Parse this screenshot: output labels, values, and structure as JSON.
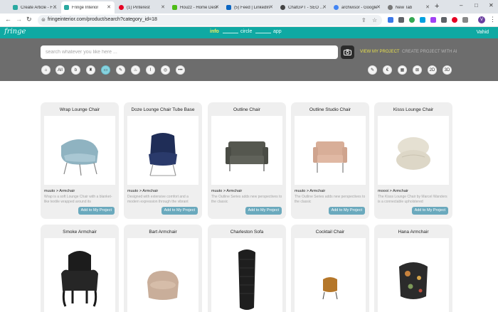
{
  "browser": {
    "tabs": [
      {
        "title": "Create Article - FRIN",
        "favicon_color": "#2aa9a0"
      },
      {
        "title": "Fringe Interior",
        "favicon_color": "#2aa9a0"
      },
      {
        "title": "(1) Pinterest",
        "favicon_color": "#e60023"
      },
      {
        "title": "Houzz - Home Desi",
        "favicon_color": "#4dbc15"
      },
      {
        "title": "(5) Feed | LinkedIn",
        "favicon_color": "#0a66c2"
      },
      {
        "title": "ChatGPT - SEO Blog",
        "favicon_color": "#444444"
      },
      {
        "title": "archivisor - Google",
        "favicon_color": "#4285f4"
      },
      {
        "title": "New Tab",
        "favicon_color": "#777777"
      }
    ],
    "new_tab_glyph": "+",
    "window_controls": [
      "–",
      "□",
      "✕"
    ],
    "url": "fringeinterior.com/product/search?category_id=18",
    "nav_glyphs": {
      "back": "←",
      "forward": "→",
      "reload": "↻"
    },
    "omnibox_icons": [
      "⇪",
      "☆"
    ],
    "profile_initial": "V"
  },
  "site": {
    "logo": "fringe",
    "nav": [
      {
        "label": "info",
        "active": true
      },
      {
        "label": "circle",
        "active": false
      },
      {
        "label": "app",
        "active": false
      }
    ],
    "user": "Vahid"
  },
  "search": {
    "placeholder": "search whatever you like here ...",
    "value": "",
    "view_project": "VIEW MY PROJECT",
    "create_project": "CREATE PROJECT WITH AI"
  },
  "filters": {
    "left": [
      {
        "icon": "home-icon",
        "glyph": "⌂"
      },
      {
        "icon": "all-icon",
        "glyph": "All"
      },
      {
        "icon": "b-icon",
        "glyph": "b"
      },
      {
        "icon": "lamp-icon",
        "glyph": "♜"
      },
      {
        "icon": "sofa-icon",
        "glyph": "▭",
        "active": true
      },
      {
        "icon": "tool-icon",
        "glyph": "✎"
      },
      {
        "icon": "decor-icon",
        "glyph": "♨"
      },
      {
        "icon": "column-icon",
        "glyph": "⌇"
      },
      {
        "icon": "globe-icon",
        "glyph": "◎"
      },
      {
        "icon": "more-icon",
        "glyph": "•••"
      }
    ],
    "right": [
      {
        "icon": "pencil-icon",
        "glyph": "✎"
      },
      {
        "icon": "coin-icon",
        "glyph": "€"
      },
      {
        "icon": "building-icon",
        "glyph": "▦"
      },
      {
        "icon": "pattern-icon",
        "glyph": "⊠"
      },
      {
        "icon": "2d-icon",
        "glyph": "2D"
      },
      {
        "icon": "3d-icon",
        "glyph": "3D"
      }
    ]
  },
  "add_button_label": "Add to My Project",
  "products": [
    {
      "title": "Wrap Lounge Chair",
      "brand": "muuto > Armchair",
      "desc": "Wrap is a soft Lounge Chair with a blanket-like textile wrapped around its",
      "color": "#8fb3c1",
      "shape": "lounge"
    },
    {
      "title": "Doze Lounge Chair Tube Base",
      "brand": "muuto > Armchair",
      "desc": "Designed with extensive comfort and a modern expression through the vibrant",
      "color": "#1f2d57",
      "shape": "tall"
    },
    {
      "title": "Outline Chair",
      "brand": "muuto > Armchair",
      "desc": "The Outline Series adds new perspectives to the classic",
      "color": "#55574f",
      "shape": "sofa"
    },
    {
      "title": "Outline Studio Chair",
      "brand": "muuto > Armchair",
      "desc": "The Outline Series adds new perspectives to the classic",
      "color": "#d8ae98",
      "shape": "sofa"
    },
    {
      "title": "Kisss Lounge Chair",
      "brand": "moooi > Armchair",
      "desc": "The Kisss Lounge Chair by Marcel Wanders is a connectable upholstered",
      "color": "#e5e0d2",
      "shape": "pouf"
    },
    {
      "title": "Smoke Armchair",
      "color": "#1c1c1c",
      "shape": "baroque"
    },
    {
      "title": "Bart Armchair",
      "color": "#c9ae9a",
      "shape": "tub"
    },
    {
      "title": "Charleston Sofa",
      "color": "#1e1e1e",
      "shape": "chesterfield"
    },
    {
      "title": "Cocktail Chair",
      "color": "#b5772a",
      "shape": "small"
    },
    {
      "title": "Hana Armchair",
      "color": "#2b2b2b",
      "shape": "floral"
    }
  ]
}
